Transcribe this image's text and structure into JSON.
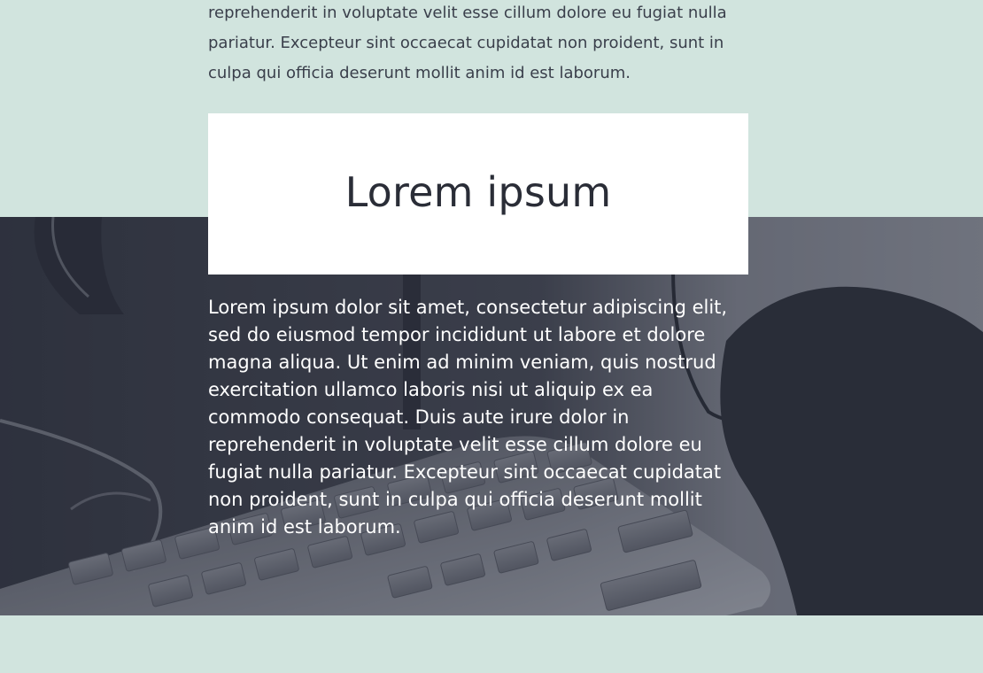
{
  "intro": {
    "text": "reprehenderit in voluptate velit esse cillum dolore eu fugiat nulla pariatur. Excepteur sint occaecat cupidatat non proident, sunt in culpa qui officia deserunt mollit anim id est laborum."
  },
  "hero": {
    "title": "Lorem ipsum",
    "text": "Lorem ipsum dolor sit amet, consectetur adipiscing elit, sed do eiusmod tempor incididunt ut labore et dolore magna aliqua. Ut enim ad minim veniam, quis nostrud exercitation ullamco laboris nisi ut aliquip ex ea commodo consequat. Duis aute irure dolor in reprehenderit in voluptate velit esse cillum dolore eu fugiat nulla pariatur. Excepteur sint occaecat cupidatat non proident, sunt in culpa qui officia deserunt mollit anim id est laborum.",
    "image": "keyboard-desk-photo"
  },
  "colors": {
    "page_bg": "#d1e4de",
    "hero_dark": "#353944",
    "card_bg": "#ffffff",
    "text_dark": "#2a2d37"
  }
}
